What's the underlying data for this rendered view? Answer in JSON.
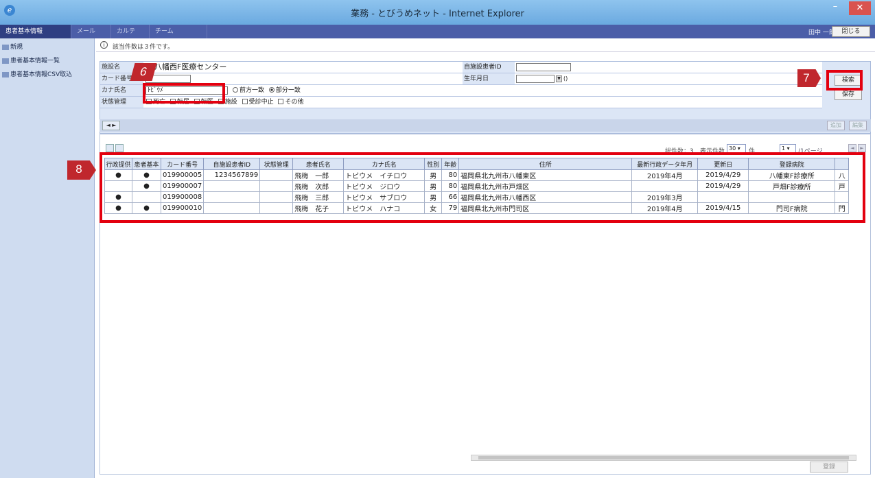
{
  "window": {
    "title": "業務 - とびうめネット - Internet Explorer",
    "min": "–",
    "max": "□",
    "close": "✕",
    "icon": "ℯ"
  },
  "tabs": [
    "患者基本情報",
    "メール",
    "カルテ",
    "チーム"
  ],
  "header": {
    "user": "田中 一郎",
    "close_label": "閉じる"
  },
  "sidebar": {
    "items": [
      {
        "label": "新規"
      },
      {
        "label": "患者基本情報一覧"
      },
      {
        "label": "患者基本情報CSV取込"
      }
    ]
  },
  "info": {
    "icon": "i",
    "message": "該当件数は３件です。"
  },
  "search": {
    "facility_label": "施設名",
    "facility_value": "八幡西F医療センター",
    "card_label": "カード番号",
    "kana_label": "カナ氏名",
    "kana_value": "ﾄﾋﾞｳﾒ",
    "match_prefix": "前方一致",
    "match_partial": "部分一致",
    "status_label": "状態管理",
    "status_options": [
      "死亡",
      "転居",
      "転医",
      "施設",
      "受診中止",
      "その他"
    ],
    "own_id_label": "自施設患者ID",
    "dob_label": "生年月日",
    "dob_suffix": "()",
    "search_button": "検索",
    "save_button": "保存",
    "pager_nav": "◄ ►",
    "btn_a": "追加",
    "btn_b": "編集"
  },
  "results": {
    "total_label": "総件数：3",
    "display_label": "表示件数",
    "display_value": "30",
    "unit_label": "件",
    "page_value": "1",
    "page_suffix": "/1ページ",
    "headers": [
      "行政提供",
      "患者基本",
      "カード番号",
      "自施設患者ID",
      "状態管理",
      "患者氏名",
      "カナ氏名",
      "性別",
      "年齢",
      "住所",
      "最新行政データ年月",
      "更新日",
      "登録病院",
      ""
    ],
    "rows": [
      [
        "●",
        "●",
        "019900005",
        "1234567899",
        "",
        "飛梅　一郎",
        "トビウメ　イチロウ",
        "男",
        "80",
        "福岡県北九州市八幡東区",
        "2019年4月",
        "2019/4/29",
        "八幡東F診療所",
        "八"
      ],
      [
        "",
        "●",
        "019900007",
        "",
        "",
        "飛梅　次郎",
        "トビウメ　ジロウ",
        "男",
        "80",
        "福岡県北九州市戸畑区",
        "",
        "2019/4/29",
        "戸畑F診療所",
        "戸"
      ],
      [
        "●",
        "",
        "019900008",
        "",
        "",
        "飛梅　三郎",
        "トビウメ　サブロウ",
        "男",
        "66",
        "福岡県北九州市八幡西区",
        "2019年3月",
        "",
        "",
        ""
      ],
      [
        "●",
        "●",
        "019900010",
        "",
        "",
        "飛梅　花子",
        "トビウメ　ハナコ",
        "女",
        "79",
        "福岡県北九州市門司区",
        "2019年4月",
        "2019/4/15",
        "門司F病院",
        "門"
      ]
    ],
    "bottom_button": "登録"
  },
  "annotations": {
    "c6": "6",
    "c7": "7",
    "c8": "8"
  },
  "colors": {
    "title_bar": "#7db8e8",
    "tab_bar": "#4b5ea8",
    "highlight": "#e3000f",
    "callout": "#c0272d"
  }
}
